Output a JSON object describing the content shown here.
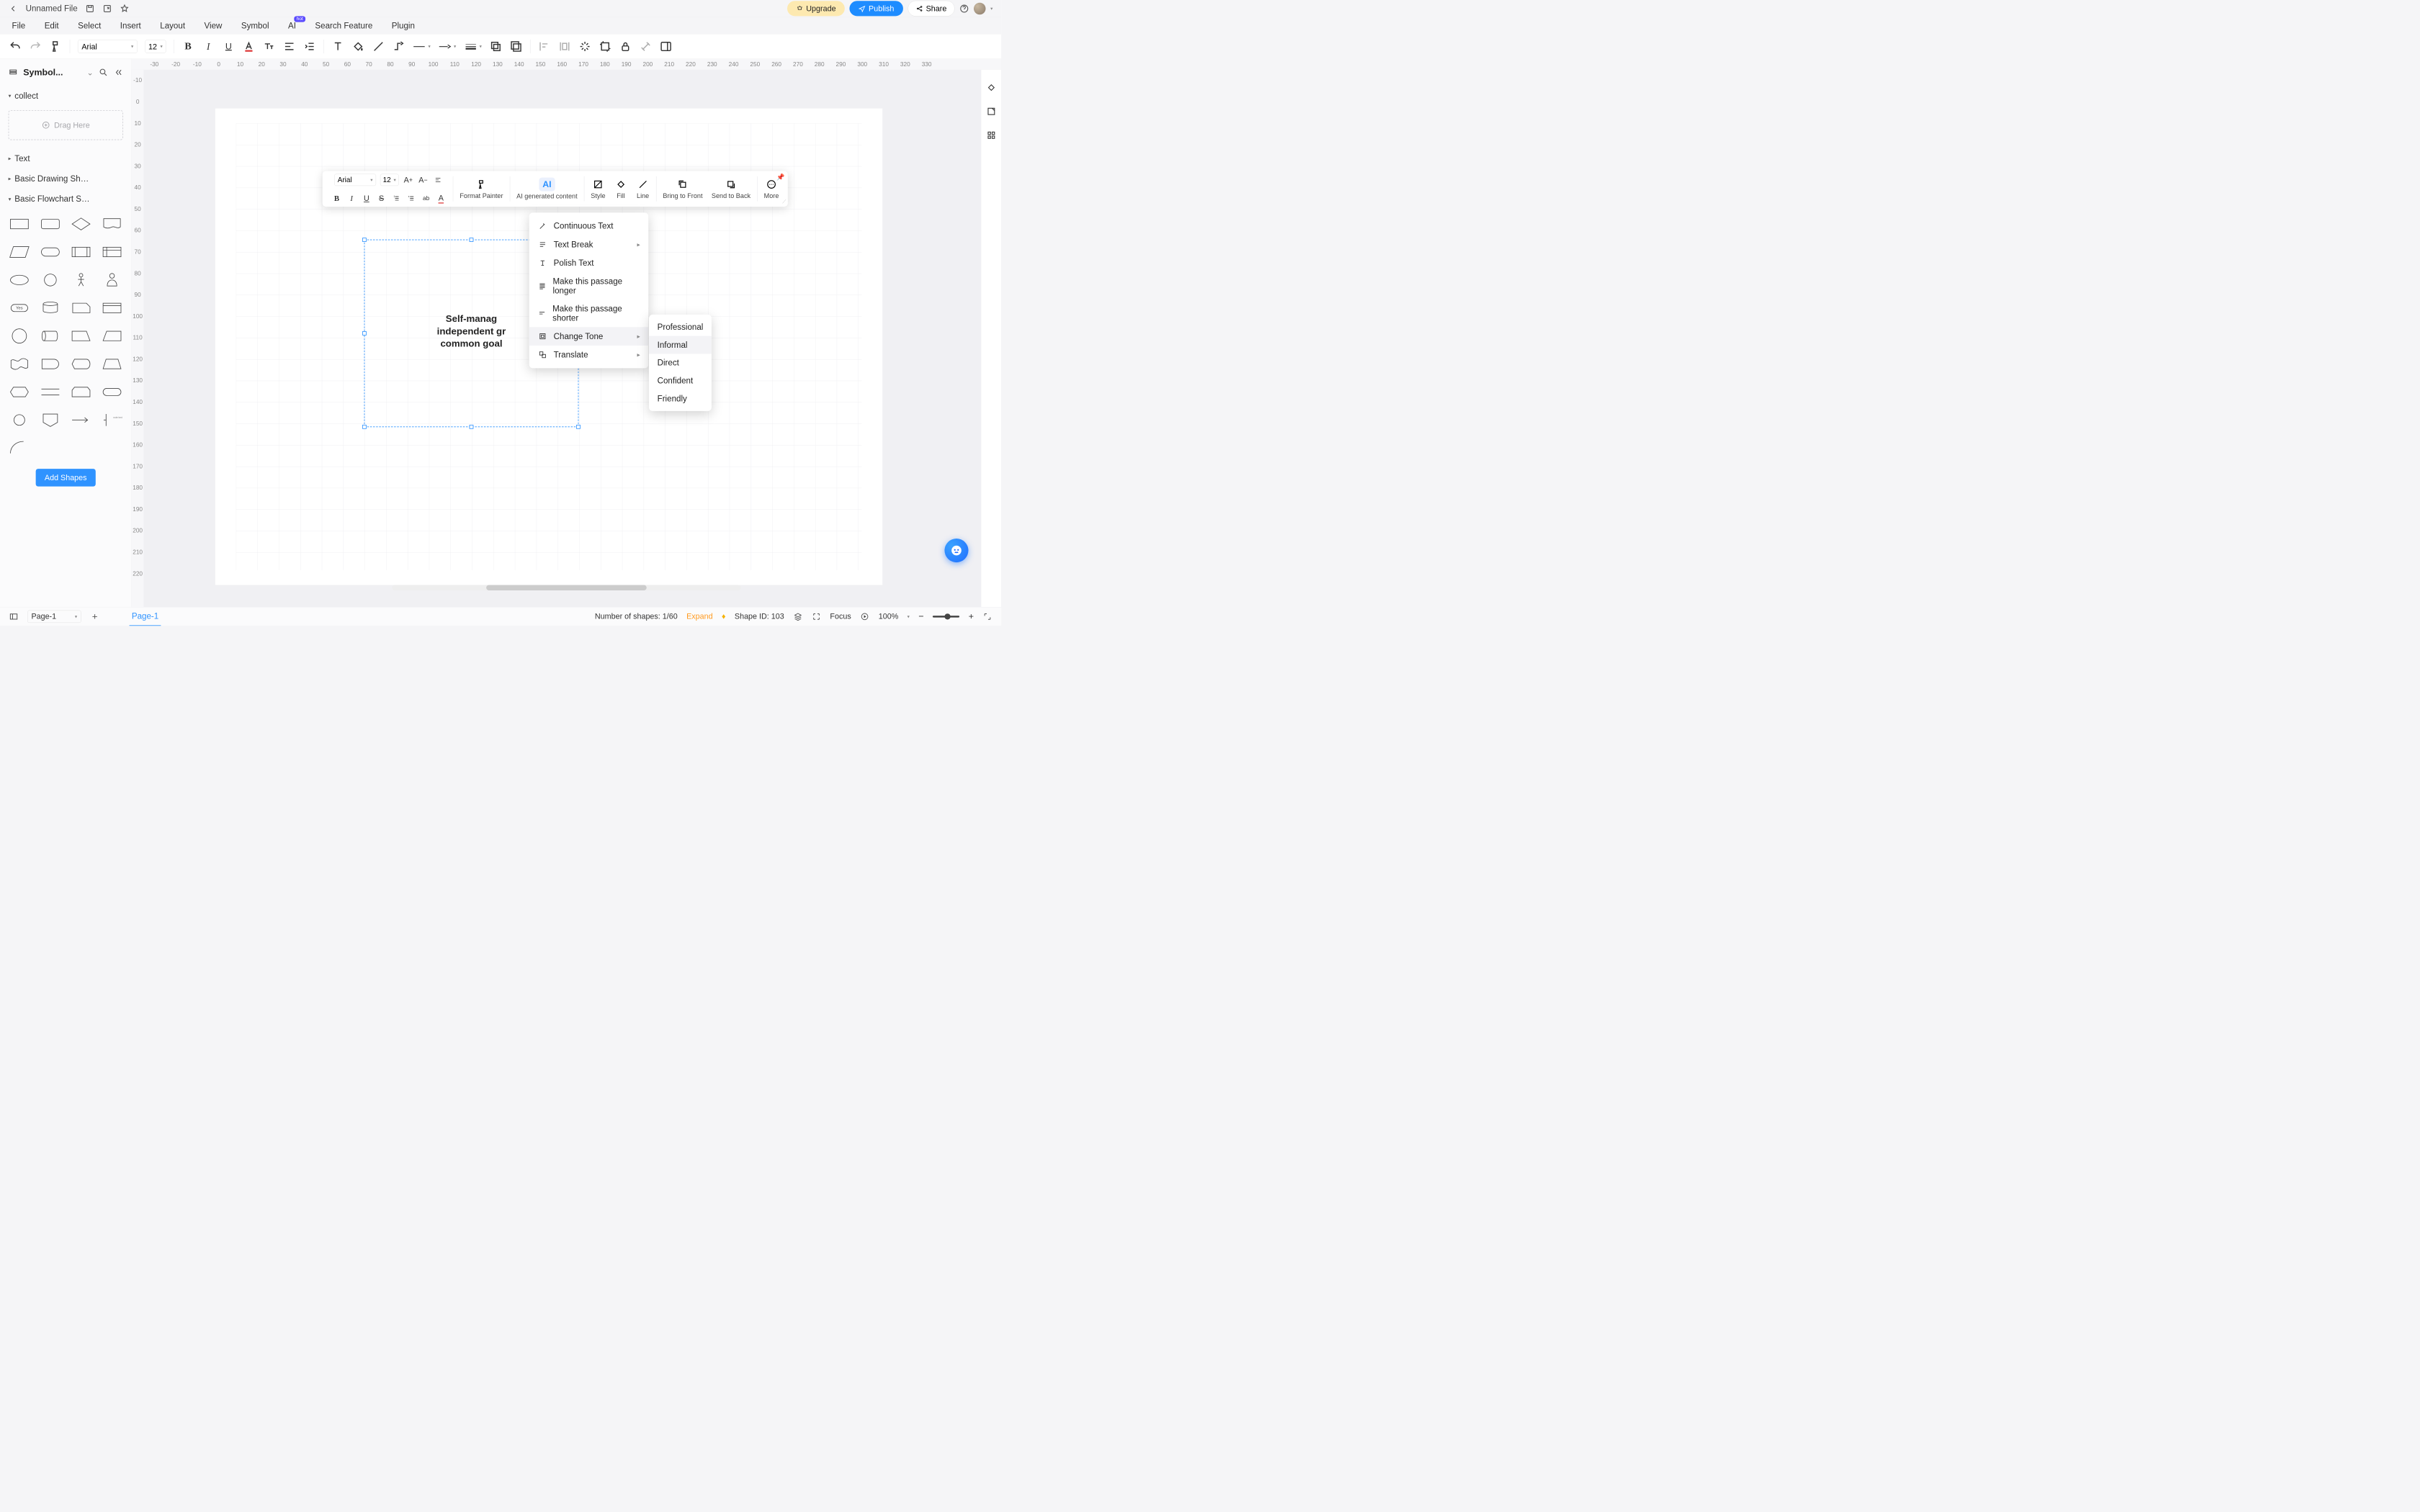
{
  "titlebar": {
    "file_name": "Unnamed File",
    "upgrade": "Upgrade",
    "publish": "Publish",
    "share": "Share"
  },
  "menubar": [
    "File",
    "Edit",
    "Select",
    "Insert",
    "Layout",
    "View",
    "Symbol",
    "AI",
    "Search Feature",
    "Plugin"
  ],
  "menubar_hot_index": 7,
  "hot_badge": "hot",
  "main_toolbar": {
    "font": "Arial",
    "size": "12"
  },
  "sidebar": {
    "title": "Symbol...",
    "drag_here": "Drag Here",
    "categories": [
      {
        "label": "collect",
        "expanded": true
      },
      {
        "label": "Text",
        "expanded": false
      },
      {
        "label": "Basic Drawing Sh…",
        "expanded": false
      },
      {
        "label": "Basic Flowchart S…",
        "expanded": true
      }
    ],
    "add_shapes": "Add Shapes"
  },
  "ruler_top": [
    "-30",
    "-20",
    "-10",
    "0",
    "10",
    "20",
    "30",
    "40",
    "50",
    "60",
    "70",
    "80",
    "90",
    "100",
    "110",
    "120",
    "130",
    "140",
    "150",
    "160",
    "170",
    "180",
    "190",
    "200",
    "210",
    "220",
    "230",
    "240",
    "250",
    "260",
    "270",
    "280",
    "290",
    "300",
    "310",
    "320",
    "330"
  ],
  "ruler_left": [
    "-10",
    "0",
    "10",
    "20",
    "30",
    "40",
    "50",
    "60",
    "70",
    "80",
    "90",
    "100",
    "110",
    "120",
    "130",
    "140",
    "150",
    "160",
    "170",
    "180",
    "190",
    "200",
    "210",
    "220"
  ],
  "selection_text": "Self-manag\nindependent gr\ncommon goal",
  "float_toolbar": {
    "font": "Arial",
    "size": "12",
    "format_painter": "Format Painter",
    "ai": "AI generated content",
    "ai_icon": "AI",
    "style": "Style",
    "fill": "Fill",
    "line": "Line",
    "front": "Bring to Front",
    "back": "Send to Back",
    "more": "More"
  },
  "ai_menu": [
    {
      "label": "Continuous Text",
      "arrow": false
    },
    {
      "label": "Text Break",
      "arrow": true
    },
    {
      "label": "Polish Text",
      "arrow": false
    },
    {
      "label": "Make this passage longer",
      "arrow": false
    },
    {
      "label": "Make this passage shorter",
      "arrow": false
    },
    {
      "label": "Change Tone",
      "arrow": true,
      "hover": true
    },
    {
      "label": "Translate",
      "arrow": true
    }
  ],
  "tone_menu": [
    "Professional",
    "Informal",
    "Direct",
    "Confident",
    "Friendly"
  ],
  "tone_hover_index": 1,
  "status": {
    "page_select": "Page-1",
    "page_tab": "Page-1",
    "shape_count_label": "Number of shapes: ",
    "shape_count": "1/60",
    "expand": "Expand",
    "shape_id_label": "Shape ID: ",
    "shape_id": "103",
    "focus": "Focus",
    "zoom": "100%"
  }
}
